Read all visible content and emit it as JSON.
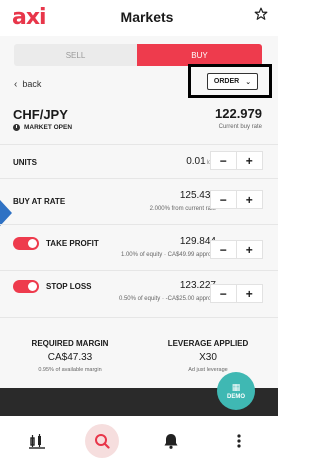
{
  "header": {
    "logo": "axi",
    "title": "Markets"
  },
  "tabs": {
    "sell": "SELL",
    "buy": "BUY"
  },
  "nav": {
    "back_label": "back",
    "order_label": "ORDER"
  },
  "instrument": {
    "pair": "CHF/JPY",
    "market_status": "MARKET OPEN",
    "price": "122.979",
    "price_sub": "Current buy rate"
  },
  "units": {
    "label": "UNITS",
    "value": "0.01",
    "unit": "lots"
  },
  "buy_at_rate": {
    "label": "BUY AT RATE",
    "value": "125.433",
    "sub": "2.000% from current rate"
  },
  "take_profit": {
    "label": "TAKE PROFIT",
    "value": "129.844",
    "sub": "1.00% of equity · CA$49.99 approx."
  },
  "stop_loss": {
    "label": "STOP LOSS",
    "value": "123.227",
    "sub": "0.50% of equity · -CA$25.00 approx."
  },
  "margin": {
    "title": "REQUIRED MARGIN",
    "value": "CA$47.33",
    "sub": "0.95% of available margin"
  },
  "leverage": {
    "title": "LEVERAGE APPLIED",
    "value": "X30",
    "sub": "Ad just leverage"
  },
  "demo": {
    "label": "DEMO"
  },
  "colors": {
    "accent": "#ee3b4d",
    "demo": "#3fb8b3",
    "marker": "#2f72c4"
  },
  "icons": [
    "star-icon",
    "chevron-left-icon",
    "chevron-down-icon",
    "clock-icon",
    "chart-icon",
    "search-icon",
    "bell-icon",
    "more-icon"
  ]
}
